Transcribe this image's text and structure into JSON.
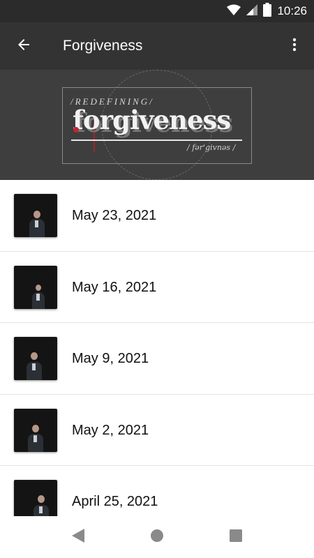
{
  "status_bar": {
    "time": "10:26",
    "icons": [
      "wifi-icon",
      "signal-icon",
      "battery-icon"
    ]
  },
  "app_bar": {
    "title": "Forgiveness",
    "back_icon": "arrow-left-icon",
    "overflow_icon": "more-vert-icon"
  },
  "banner": {
    "kicker": "/REDEFINING/",
    "title": "forgiveness",
    "phonetic": "/ fər'givnəs /"
  },
  "sermons": [
    {
      "date": "May 23, 2021"
    },
    {
      "date": "May 16, 2021"
    },
    {
      "date": "May 9, 2021"
    },
    {
      "date": "May 2, 2021"
    },
    {
      "date": "April 25, 2021"
    }
  ],
  "nav_bar": {
    "icons": [
      "nav-back-icon",
      "nav-home-icon",
      "nav-recents-icon"
    ]
  },
  "colors": {
    "status_bar": "#2b2b2b",
    "app_bar": "#333333",
    "banner_bg": "#3e3e3f",
    "accent_red": "#c0262d"
  }
}
